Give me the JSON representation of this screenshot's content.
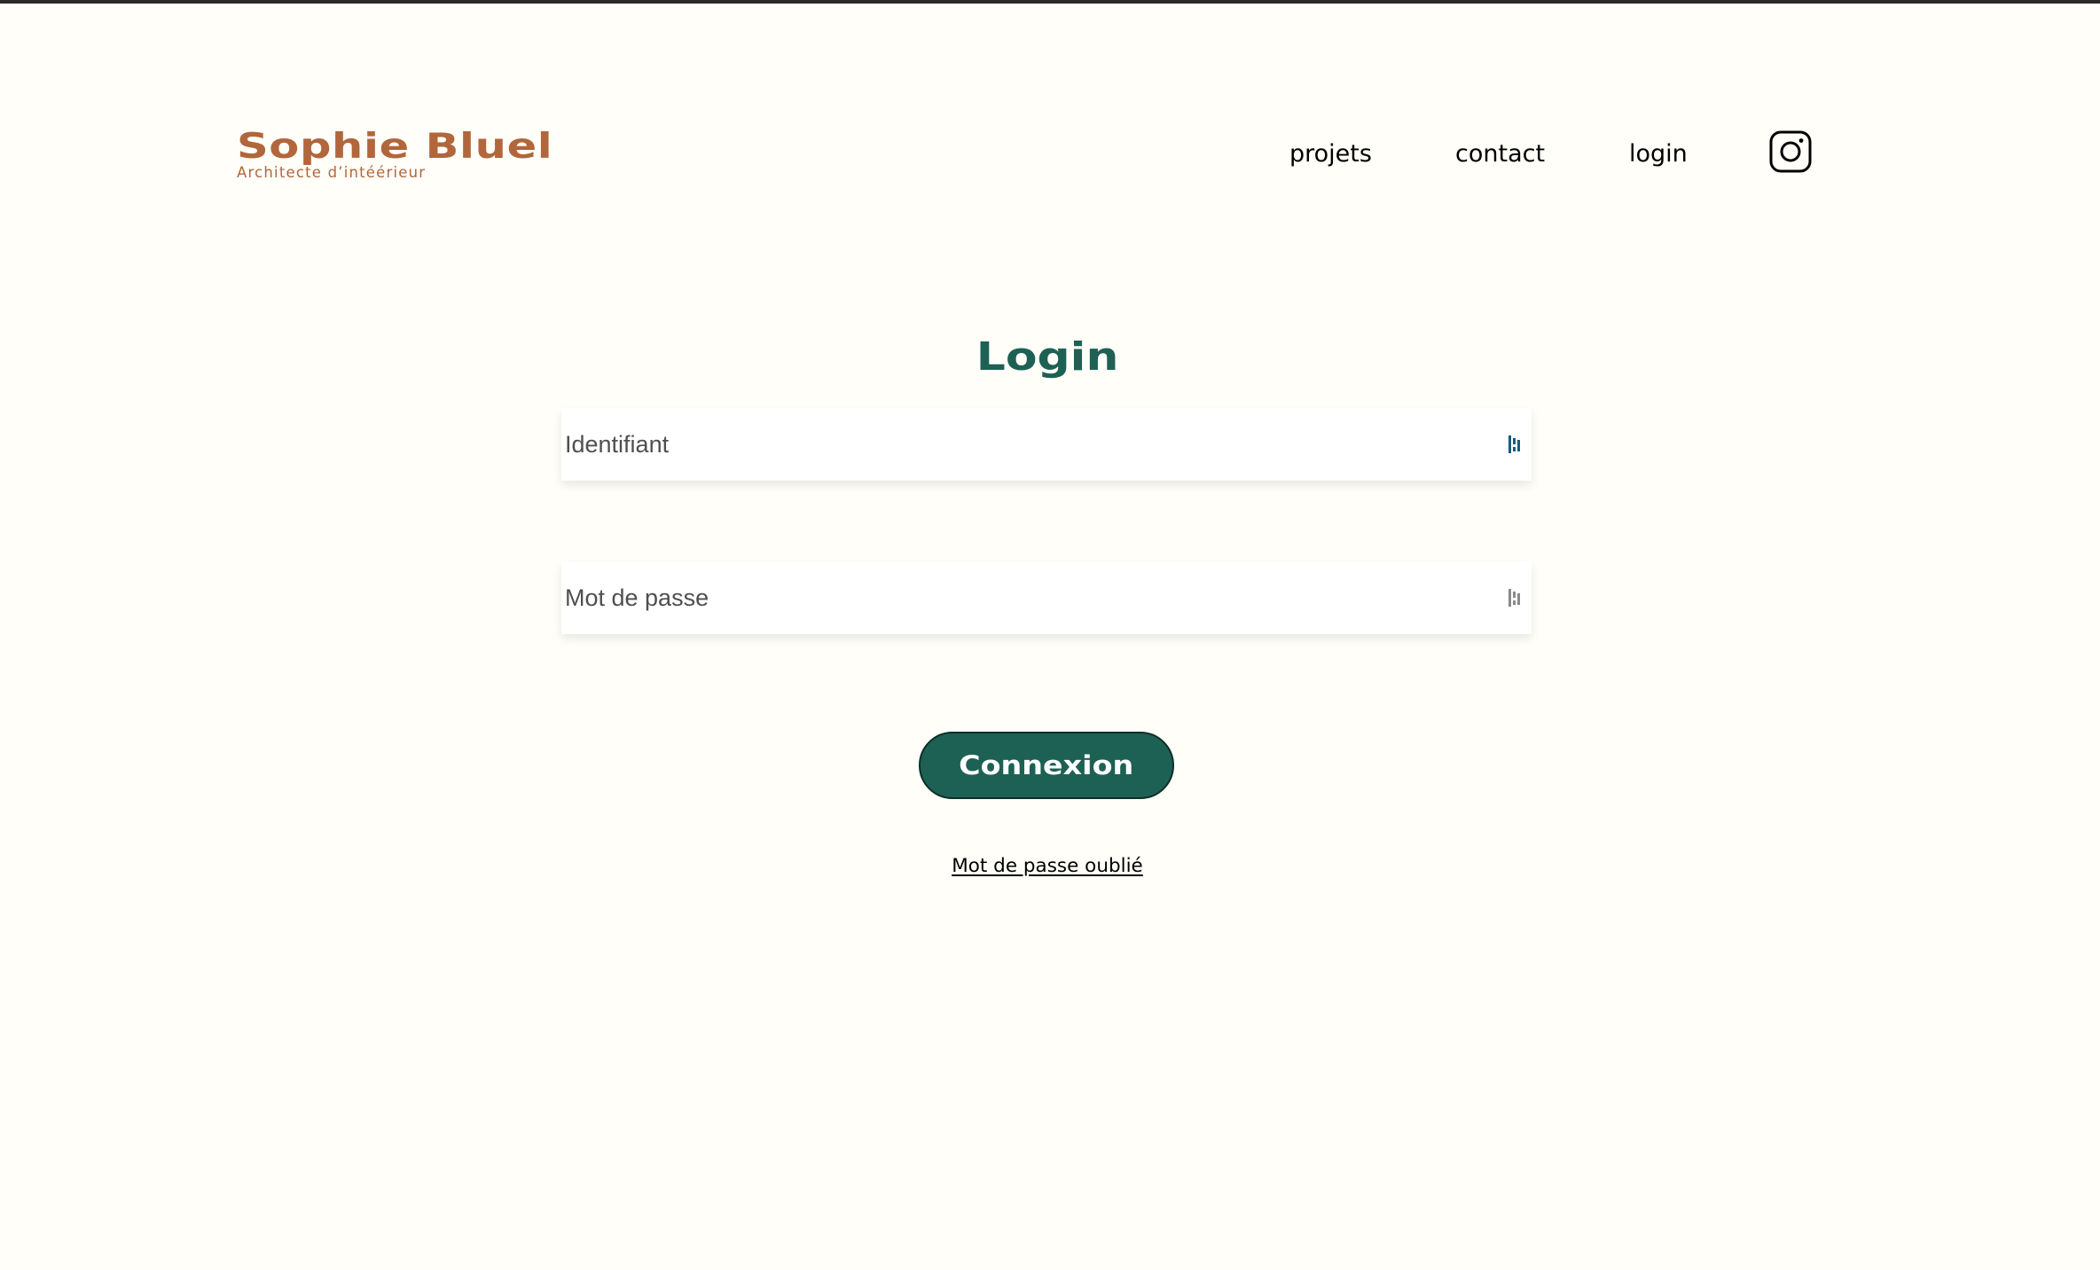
{
  "header": {
    "logo_title": "Sophie Bluel",
    "logo_subtitle": "Architecte d’intéérieur",
    "nav": {
      "projets": "projets",
      "contact": "contact",
      "login": "login"
    },
    "social_icon": "instagram-icon"
  },
  "login": {
    "title": "Login",
    "identifier_placeholder": "Identifiant",
    "identifier_value": "",
    "password_placeholder": "Mot de passe",
    "password_value": "",
    "field_icon": "password-manager-icon",
    "submit_label": "Connexion",
    "forgot_label": "Mot de passe oublié"
  },
  "colors": {
    "brand": "#B1663C",
    "primary": "#1D6154",
    "background": "#FFFEF8"
  }
}
